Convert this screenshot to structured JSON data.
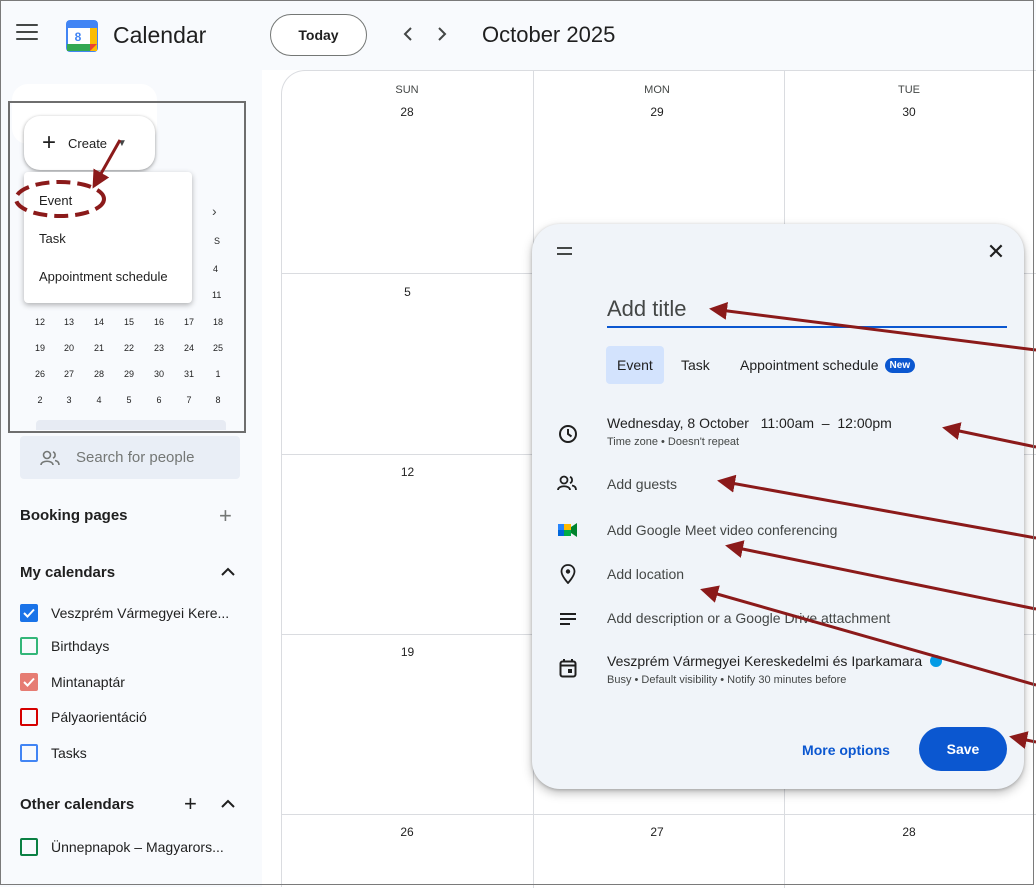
{
  "app": {
    "title": "Calendar",
    "logo_day": "8"
  },
  "toolbar": {
    "today_label": "Today",
    "month_title": "October 2025"
  },
  "sidebar": {
    "create_label": "Create",
    "create_menu": [
      "Event",
      "Task",
      "Appointment schedule"
    ],
    "mini_calendar": {
      "right_column": [
        "S",
        "4",
        "11"
      ],
      "rows": [
        [
          "12",
          "13",
          "14",
          "15",
          "16",
          "17",
          "18"
        ],
        [
          "19",
          "20",
          "21",
          "22",
          "23",
          "24",
          "25"
        ],
        [
          "26",
          "27",
          "28",
          "29",
          "30",
          "31",
          "1"
        ],
        [
          "2",
          "3",
          "4",
          "5",
          "6",
          "7",
          "8"
        ]
      ]
    },
    "search_placeholder": "Search for people",
    "booking_pages": "Booking pages",
    "my_calendars_title": "My calendars",
    "my_calendars": [
      {
        "label": "Veszprém Vármegyei Kere...",
        "color": "#1a73e8",
        "checked": true
      },
      {
        "label": "Birthdays",
        "color": "#33b679",
        "checked": false
      },
      {
        "label": "Mintanaptár",
        "color": "#e67c73",
        "checked": true
      },
      {
        "label": "Pályaorientáció",
        "color": "#d50000",
        "checked": false
      },
      {
        "label": "Tasks",
        "color": "#4285f4",
        "checked": false
      }
    ],
    "other_calendars_title": "Other calendars",
    "other_calendars": [
      {
        "label": "Ünnepnapok – Magyarors...",
        "color": "#0b8043",
        "checked": false
      }
    ]
  },
  "grid": {
    "days": [
      {
        "name": "SUN",
        "date": "28"
      },
      {
        "name": "MON",
        "date": "29"
      },
      {
        "name": "TUE",
        "date": "30"
      }
    ],
    "week_starts": [
      "5",
      "12",
      "19"
    ],
    "last_row": [
      "26",
      "27",
      "28"
    ]
  },
  "dialog": {
    "title_placeholder": "Add title",
    "tabs": [
      "Event",
      "Task",
      "Appointment schedule"
    ],
    "new_badge": "New",
    "datetime_date": "Wednesday, 8 October",
    "datetime_time": "11:00am  –  12:00pm",
    "datetime_sub": "Time zone • Doesn't repeat",
    "add_guests": "Add guests",
    "add_meet": "Add Google Meet video conferencing",
    "add_location": "Add location",
    "add_description": "Add description or a Google Drive attachment",
    "calendar_name": "Veszprém Vármegyei Kereskedelmi és Iparkamara",
    "calendar_sub": "Busy • Default visibility • Notify 30 minutes before",
    "more_options": "More options",
    "save": "Save"
  },
  "colors": {
    "accent": "#0b57d0",
    "annotation": "#8b1a1a"
  }
}
